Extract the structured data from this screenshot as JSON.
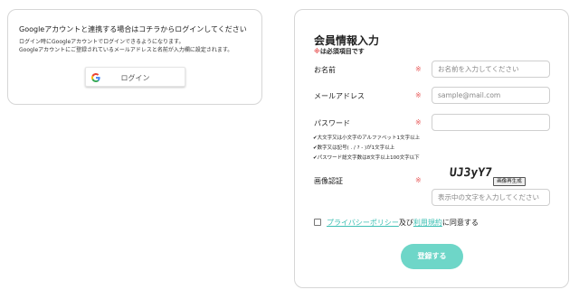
{
  "google_panel": {
    "title": "Googleアカウントと連携する場合はコチラからログインしてください",
    "desc_line1": "ログイン時にGoogleアカウントでログインできるようになります。",
    "desc_line2": "Googleアカウントにご登録されているメールアドレスと名前が入力欄に設定されます。",
    "login_button": "ログイン",
    "icon": "google-g-icon"
  },
  "register": {
    "title": "会員情報入力",
    "required_mark": "※",
    "required_note": "は必須項目です",
    "fields": {
      "name": {
        "label": "お名前",
        "mark": "※",
        "placeholder": "お名前を入力してください"
      },
      "email": {
        "label": "メールアドレス",
        "mark": "※",
        "placeholder": "sample@mail.com"
      },
      "password": {
        "label": "パスワード",
        "mark": "※",
        "placeholder": ""
      },
      "captcha": {
        "label": "画像認証",
        "mark": "※",
        "placeholder": "表示中の文字を入力してください"
      }
    },
    "password_rules": [
      "✔大文字又は小文字のアルファベット1文字以上",
      "✔数字又は記号( . / ? - )が1文字以上",
      "✔パスワード総文字数は8文字以上100文字以下"
    ],
    "captcha_text": "UJ3yY7",
    "captcha_regen": "画像再生成",
    "agree": {
      "privacy_link": "プライバシーポリシー",
      "conj": "及び",
      "terms_link": "利用規約",
      "suffix": "に同意する"
    },
    "submit": "登録する"
  },
  "colors": {
    "accent": "#6ed6c8",
    "link": "#3cbfb3",
    "required": "#e85a5a"
  }
}
